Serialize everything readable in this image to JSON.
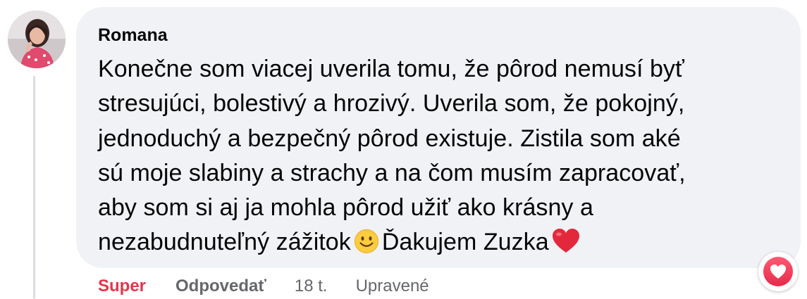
{
  "comment": {
    "author": "Romana",
    "lines": [
      "Konečne som viacej uverila tomu, že pôrod nemusí byť",
      "stresujúci, bolestivý a hrozivý. Uverila som, že pokojný,",
      "jednoduchý a bezpečný pôrod existuje. Zistila som aké",
      "sú moje slabiny a strachy a na čom musím zapracovať,",
      "aby som si aj ja mohla pôrod užiť ako krásny a"
    ],
    "last_line_part1": "nezabudnuteľný zážitok",
    "last_line_part2": "Ďakujem Zuzka",
    "emojis": [
      "smiling-face-emoji",
      "red-heart-emoji"
    ],
    "reaction": "love-reaction-icon"
  },
  "actions": {
    "reaction_label": "Super",
    "reply_label": "Odpovedať",
    "time": "18 t.",
    "edited": "Upravené"
  },
  "colors": {
    "bubble": "#f0f2f5",
    "text": "#050505",
    "secondary": "#65676b",
    "reaction_active": "#e4354d"
  }
}
